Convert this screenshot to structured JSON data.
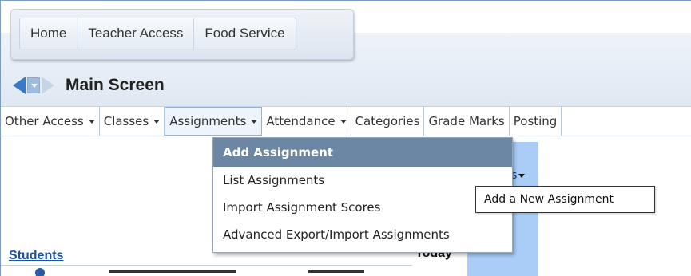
{
  "top_tabs": [
    "Home",
    "Teacher Access",
    "Food Service"
  ],
  "page_title": "Main Screen",
  "menu_items": [
    {
      "label": "Other Access",
      "has_caret": true
    },
    {
      "label": "Classes",
      "has_caret": true
    },
    {
      "label": "Assignments",
      "has_caret": true
    },
    {
      "label": "Attendance",
      "has_caret": true
    },
    {
      "label": "Categories",
      "has_caret": false
    },
    {
      "label": "Grade Marks",
      "has_caret": false
    },
    {
      "label": "Posting",
      "has_caret": false
    }
  ],
  "dropdown": {
    "items": [
      "Add Assignment",
      "List Assignments",
      "Import Assignment Scores",
      "Advanced Export/Import Assignments"
    ],
    "highlighted_index": 0
  },
  "tooltip": "Add a New Assignment",
  "content": {
    "students_link": "Students",
    "today_header": "Today",
    "partial_column_text": "s"
  },
  "colors": {
    "accent": "#3a78c8",
    "highlight": "#6c87a3",
    "column_blue": "#a9cdf6",
    "link": "#1a50a8"
  },
  "icons": {
    "back": "arrow-left-icon",
    "history": "history-dropdown-icon",
    "forward": "arrow-right-icon",
    "caret": "caret-down-icon"
  }
}
